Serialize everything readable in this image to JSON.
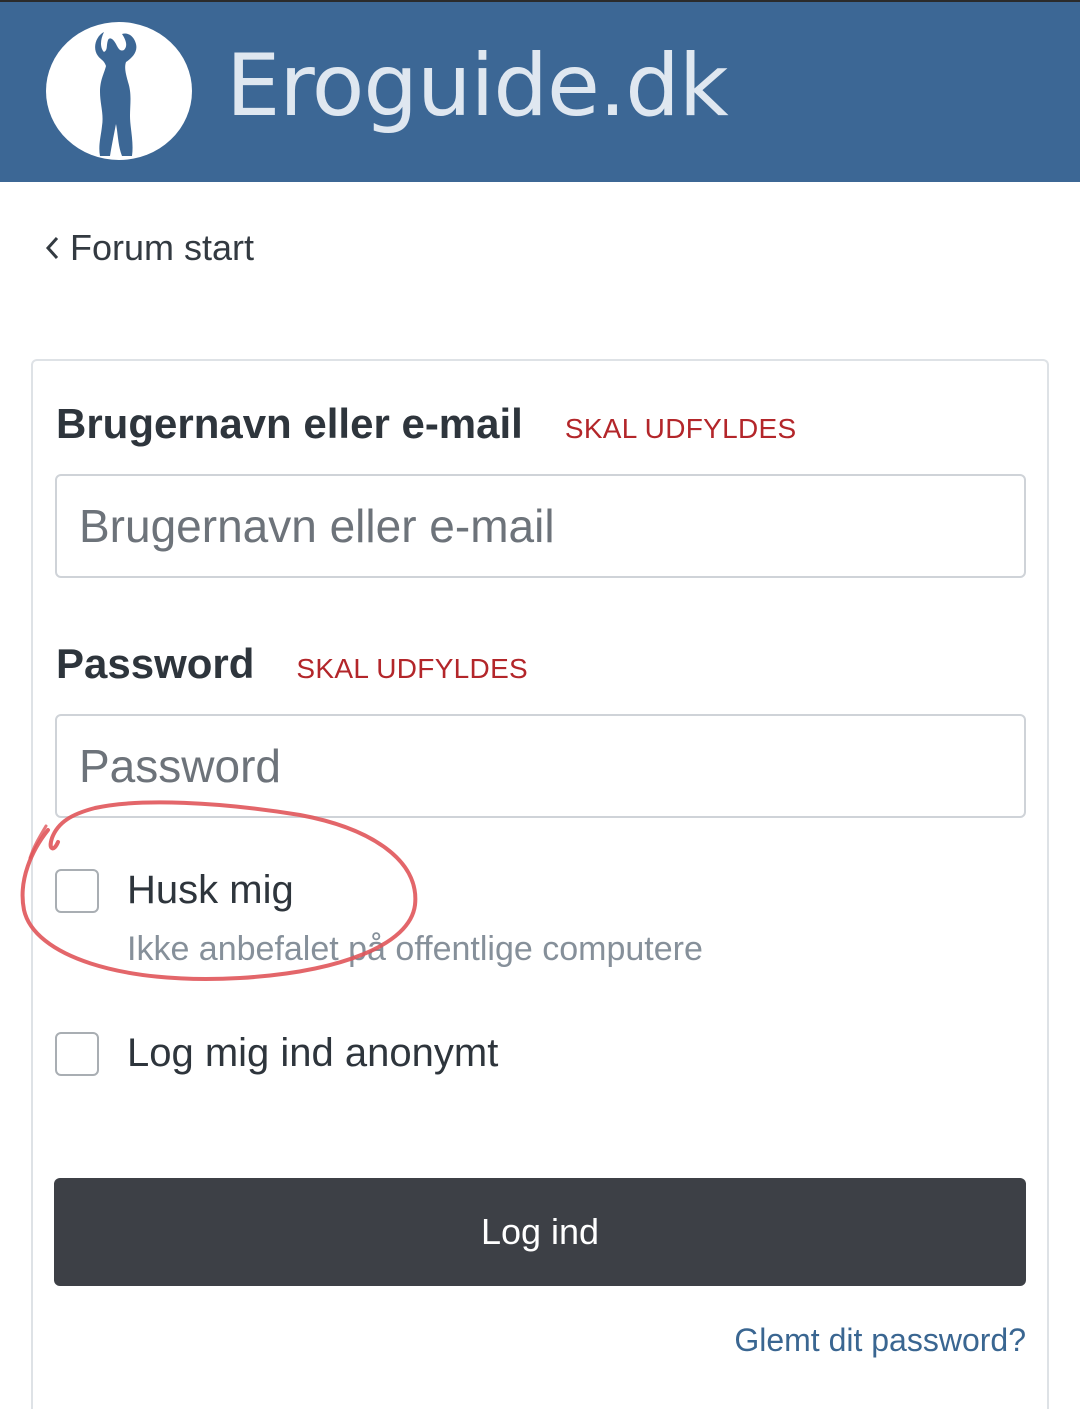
{
  "header": {
    "site_name": "Eroguide.dk",
    "logo_icon": "woman-silhouette-logo",
    "background_color": "#3c6795"
  },
  "nav": {
    "back_label": "Forum start",
    "back_icon": "chevron-left-icon"
  },
  "login_form": {
    "username": {
      "label": "Brugernavn eller e-mail",
      "required_text": "SKAL UDFYLDES",
      "placeholder": "Brugernavn eller e-mail",
      "value": ""
    },
    "password": {
      "label": "Password",
      "required_text": "SKAL UDFYLDES",
      "placeholder": "Password",
      "value": ""
    },
    "remember_me": {
      "label": "Husk mig",
      "hint": "Ikke anbefalet på offentlige computere",
      "checked": false
    },
    "anonymous": {
      "label": "Log mig ind anonymt",
      "checked": false
    },
    "submit_label": "Log ind",
    "forgot_label": "Glemt dit password?"
  },
  "colors": {
    "required": "#b3262a",
    "button": "#3d4046",
    "link": "#3a6691",
    "annotation": "#e0555a"
  }
}
